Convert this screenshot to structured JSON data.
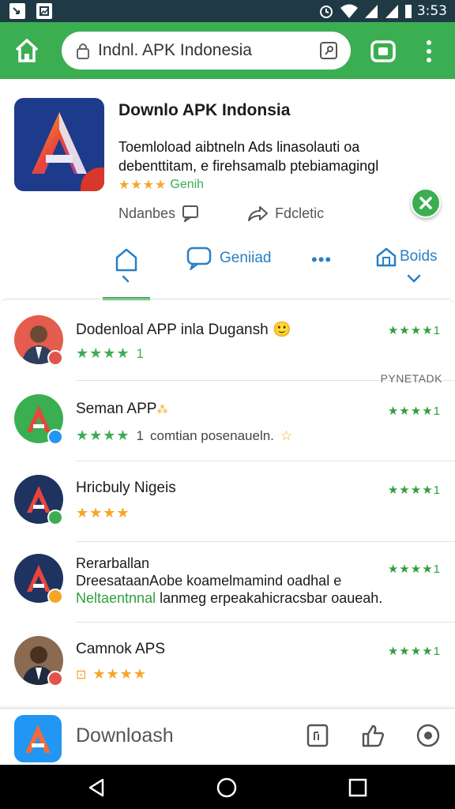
{
  "status_bar": {
    "time": "3:53"
  },
  "toolbar": {
    "url": "Indnl. APK Indonesia"
  },
  "app": {
    "title": "Downlo APK Indonsia",
    "description": "Toemloload aibtneln Ads linasolauti oa debenttitam, e firehsamalb ptebiamagingl",
    "stars": "★★★★",
    "rating_text": "Genih",
    "action_1": "Ndanbes",
    "action_2": "Fdcletic"
  },
  "tabs": {
    "general": "Geniiad",
    "more": "•••",
    "boids": "Boids"
  },
  "side_tag": "PYNETADK",
  "list": [
    {
      "title": "Dodenloal APP inla Dugansh",
      "emoji": "🙂",
      "rating": "★★★★1",
      "sub_stars": "★★★★",
      "sub_suffix": "1",
      "sub_text": ""
    },
    {
      "title": "Seman APP",
      "emoji": "⁂",
      "rating": "★★★★1",
      "sub_stars": "★★★★",
      "sub_suffix": "1",
      "sub_text": "comtian posenaueln."
    },
    {
      "title": "Hricbuly Nigeis",
      "rating": "★★★★1",
      "sub_stars": "★★★★"
    },
    {
      "title": "Rerarballan",
      "line2": "DreesataanAobe koamelmamind oadhal e",
      "line3_green": "Neltaentnnal",
      "line3_rest": " lanmeg erpeakahicracsbar oaueah.",
      "rating": "★★★★1"
    },
    {
      "title": "Camnok APS",
      "rating": "★★★★1",
      "sub_stars": "★★★★"
    }
  ],
  "bottom_bar": {
    "label": "Downloash"
  },
  "colors": {
    "brand_green": "#3cae52",
    "link_blue": "#2a7fc4",
    "star_orange": "#f5a623",
    "status_bar": "#1f3a45"
  },
  "icons": [
    "home-icon",
    "lock-icon",
    "page-icon",
    "tabs-icon",
    "overflow-menu-icon",
    "comment-icon",
    "share-icon",
    "close-icon",
    "chat-icon",
    "home-house-icon",
    "back-icon",
    "circle-home-icon",
    "recents-icon",
    "clipboard-icon",
    "thumbs-up-icon",
    "record-icon"
  ]
}
